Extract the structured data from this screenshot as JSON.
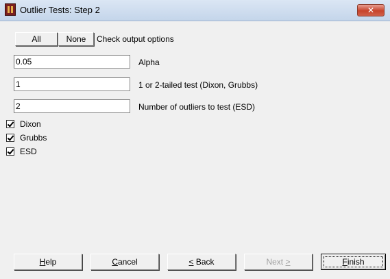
{
  "window": {
    "title": "Outlier Tests: Step 2",
    "close_glyph": "✕"
  },
  "options_bar": {
    "all_label": "All",
    "none_label": "None",
    "caption": "Check output options"
  },
  "fields": [
    {
      "value": "0.05",
      "label": "Alpha"
    },
    {
      "value": "1",
      "label": "1 or 2-tailed test (Dixon, Grubbs)"
    },
    {
      "value": "2",
      "label": "Number of outliers to test (ESD)"
    }
  ],
  "checkboxes": [
    {
      "label": "Dixon",
      "checked": true
    },
    {
      "label": "Grubbs",
      "checked": true
    },
    {
      "label": "ESD",
      "checked": true
    }
  ],
  "footer": {
    "help": {
      "mnemonic": "H",
      "rest": "elp"
    },
    "cancel": {
      "mnemonic": "C",
      "rest": "ancel"
    },
    "back": {
      "mnemonic": "<",
      "rest": " Back"
    },
    "next": {
      "label": "Next",
      "suffix": ">"
    },
    "finish": {
      "mnemonic": "F",
      "rest": "inish"
    }
  },
  "icons": {
    "app": "app-icon",
    "close": "close-icon",
    "check": "check-icon"
  }
}
